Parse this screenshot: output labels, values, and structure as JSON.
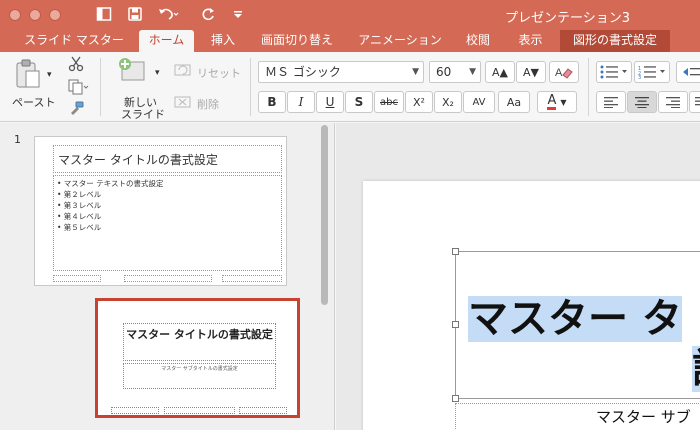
{
  "window": {
    "title": "プレゼンテーション3"
  },
  "tabs": [
    {
      "label": "スライド マスター"
    },
    {
      "label": "ホーム"
    },
    {
      "label": "挿入"
    },
    {
      "label": "画面切り替え"
    },
    {
      "label": "アニメーション"
    },
    {
      "label": "校閲"
    },
    {
      "label": "表示"
    },
    {
      "label": "図形の書式設定"
    }
  ],
  "ribbon": {
    "paste_label": "ペースト",
    "new_slide_line1": "新しい",
    "new_slide_line2": "スライド",
    "reset_label": "リセット",
    "delete_label": "削除",
    "font_name": "ＭＳ ゴシック",
    "font_size": "60",
    "bold": "B",
    "italic": "I",
    "underline": "U",
    "shadow": "S",
    "strikethrough": "abc",
    "superscript": "X²",
    "subscript": "X₂",
    "char_spacing": "AV",
    "change_case": "Aa",
    "font_color": "A",
    "grow_font": "A▲",
    "shrink_font": "A▼"
  },
  "colors": {
    "accent": "#d46a55",
    "selection": "#c8432f",
    "text_highlight": "#c4dcf5"
  },
  "thumbnails": {
    "slide1_number": "1",
    "slide1_title": "マスター タイトルの書式設定",
    "slide1_bullets": [
      "• マスター テキストの書式設定",
      "• 第２レベル",
      "• 第３レベル",
      "• 第４レベル",
      "• 第５レベル"
    ],
    "slide2_title": "マスター タイトルの書式設定",
    "slide2_subtitle": "マスター サブタイトルの書式設定"
  },
  "editor": {
    "title_line1": "マスター タ",
    "title_line2": "設",
    "subtitle": "マスター サブ"
  }
}
